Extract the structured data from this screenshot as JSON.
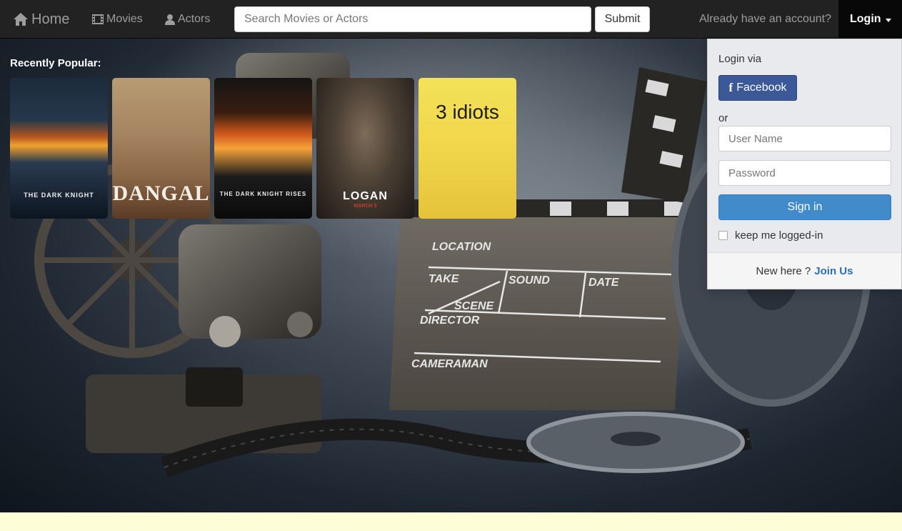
{
  "navbar": {
    "home_label": "Home",
    "movies_label": "Movies",
    "actors_label": "Actors",
    "search_placeholder": "Search Movies or Actors",
    "submit_label": "Submit",
    "account_prompt": "Already have an account?",
    "login_label": "Login"
  },
  "popular": {
    "title": "Recently Popular:",
    "posters": [
      {
        "title": "THE DARK KNIGHT"
      },
      {
        "title": "DANGAL"
      },
      {
        "title": "THE DARK KNIGHT RISES"
      },
      {
        "title": "LOGAN",
        "subtitle": "MARCH 3"
      },
      {
        "title": "3 idiots"
      }
    ]
  },
  "login_panel": {
    "via_label": "Login via",
    "facebook_label": "Facebook",
    "or_label": "or",
    "username_placeholder": "User Name",
    "password_placeholder": "Password",
    "signin_label": "Sign in",
    "keep_label": "keep me logged-in",
    "new_here": "New here ?",
    "join_label": "Join Us"
  },
  "hero_scene": {
    "location_label": "LOCATION",
    "take_label": "TAKE",
    "sound_label": "SOUND",
    "date_label": "DATE",
    "scene_label": "SCENE",
    "director_label": "DIRECTOR",
    "cameraman_label": "CAMERAMAN"
  },
  "colors": {
    "navbar_bg": "#222222",
    "facebook": "#3b5998",
    "signin": "#428bca",
    "join_link": "#2a6fb0",
    "footer": "#fdfdd8"
  }
}
